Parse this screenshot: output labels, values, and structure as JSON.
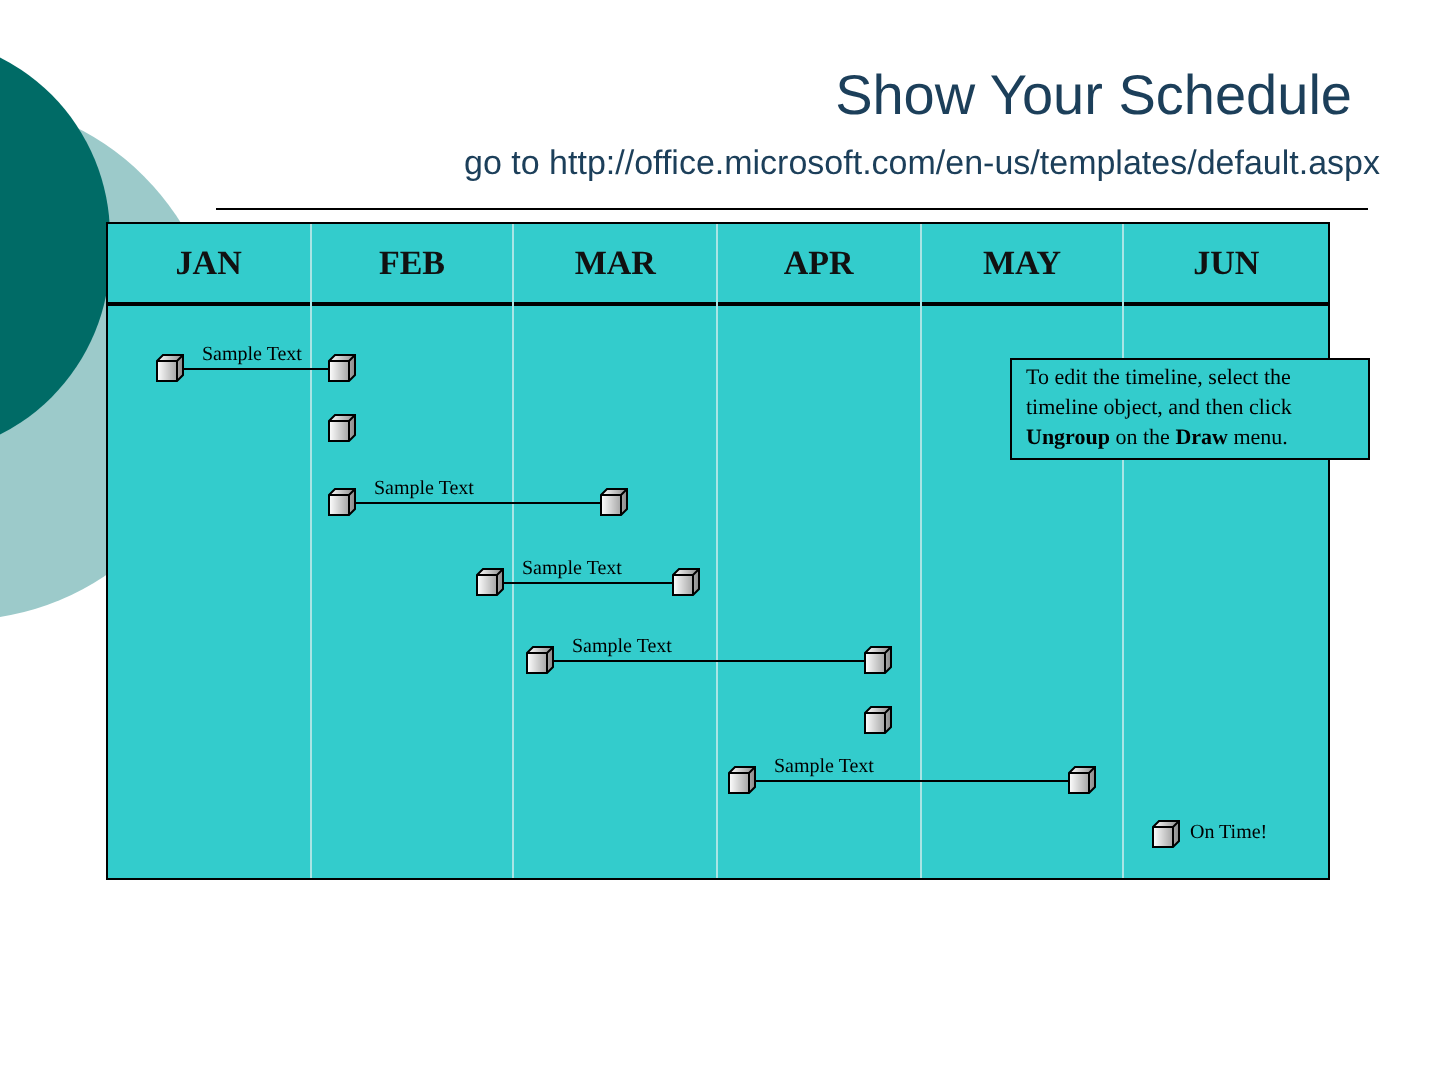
{
  "title": "Show Your Schedule",
  "subtitle": "go to http://office.microsoft.com/en-us/templates/default.aspx",
  "timeline": {
    "months": [
      "JAN",
      "FEB",
      "MAR",
      "APR",
      "MAY",
      "JUN"
    ],
    "items": [
      {
        "kind": "span",
        "label": "Sample Text"
      },
      {
        "kind": "milestone"
      },
      {
        "kind": "span",
        "label": "Sample Text"
      },
      {
        "kind": "span",
        "label": "Sample Text"
      },
      {
        "kind": "span",
        "label": "Sample Text"
      },
      {
        "kind": "milestone"
      },
      {
        "kind": "span",
        "label": "Sample Text"
      },
      {
        "kind": "milestone",
        "label": "On Time!"
      }
    ],
    "note": "To edit the timeline, select the timeline object, and then click **Ungroup** on the **Draw** menu."
  }
}
